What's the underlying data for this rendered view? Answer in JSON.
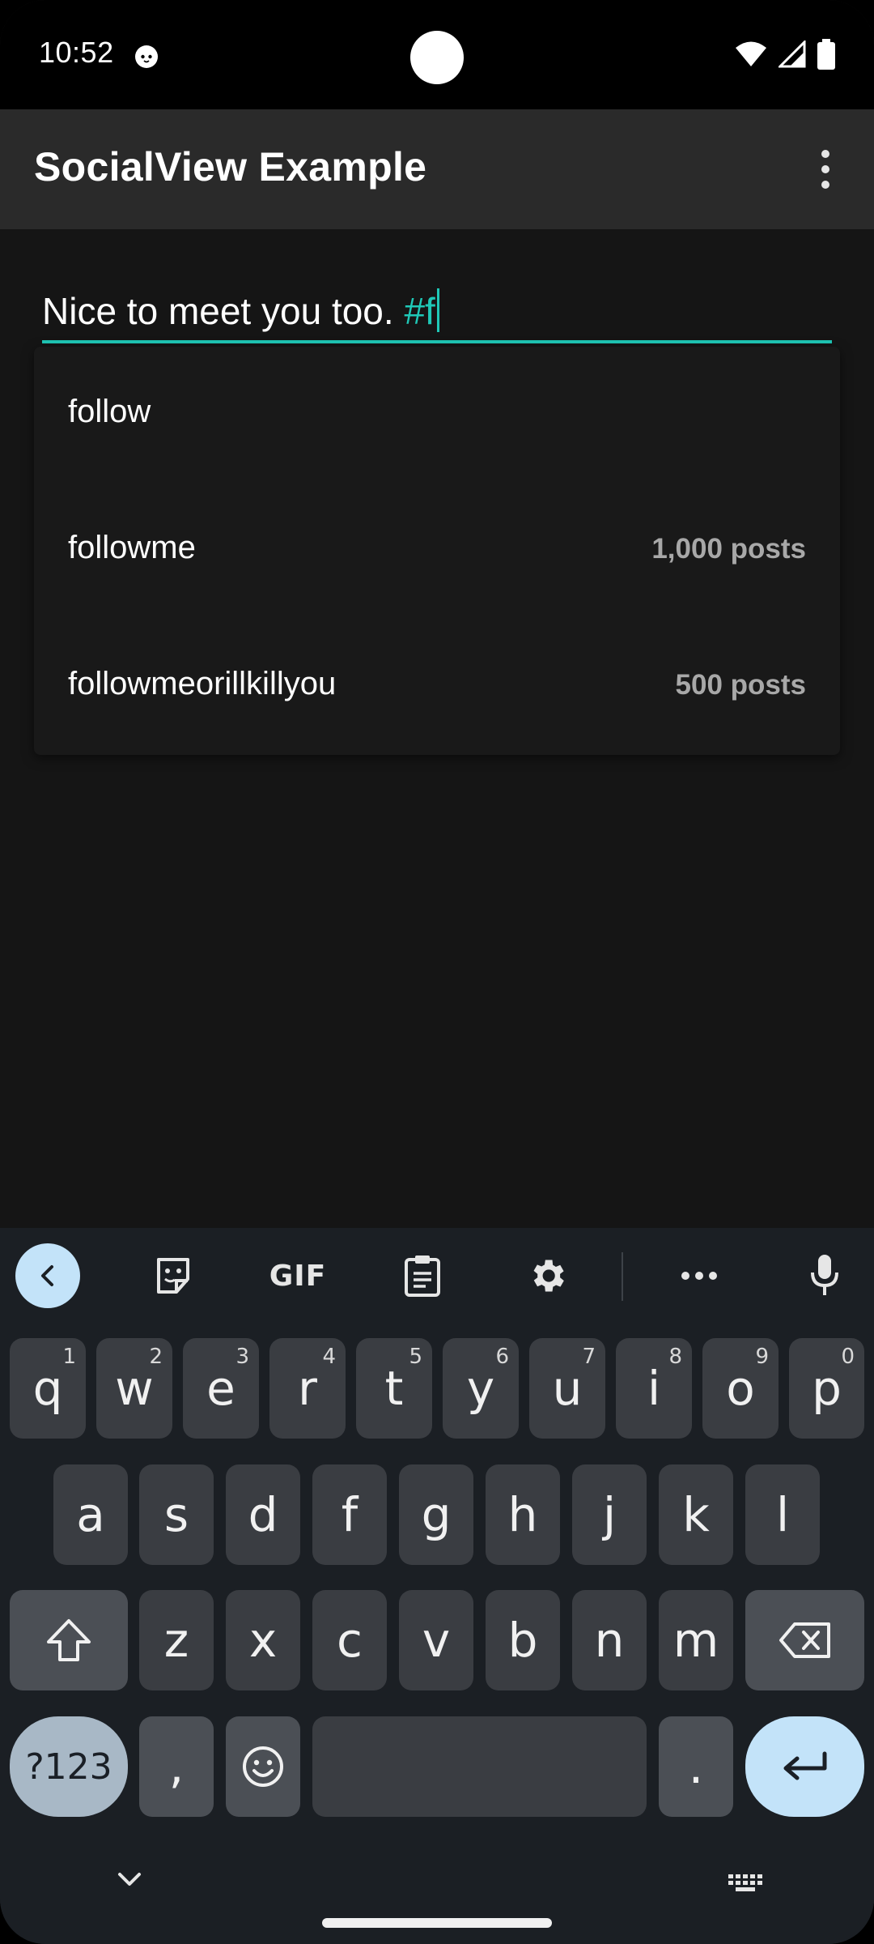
{
  "status": {
    "time": "10:52"
  },
  "appbar": {
    "title": "SocialView Example"
  },
  "input": {
    "text_prefix": "Nice to meet you too. ",
    "hashtag": "#f"
  },
  "suggestions": [
    {
      "name": "follow",
      "count": ""
    },
    {
      "name": "followme",
      "count": "1,000 posts"
    },
    {
      "name": "followmeorillkillyou",
      "count": "500 posts"
    }
  ],
  "keyboard": {
    "toolbar": {
      "gif_label": "GIF"
    },
    "row1": [
      {
        "key": "q",
        "hint": "1"
      },
      {
        "key": "w",
        "hint": "2"
      },
      {
        "key": "e",
        "hint": "3"
      },
      {
        "key": "r",
        "hint": "4"
      },
      {
        "key": "t",
        "hint": "5"
      },
      {
        "key": "y",
        "hint": "6"
      },
      {
        "key": "u",
        "hint": "7"
      },
      {
        "key": "i",
        "hint": "8"
      },
      {
        "key": "o",
        "hint": "9"
      },
      {
        "key": "p",
        "hint": "0"
      }
    ],
    "row2": [
      "a",
      "s",
      "d",
      "f",
      "g",
      "h",
      "j",
      "k",
      "l"
    ],
    "row3": [
      "z",
      "x",
      "c",
      "v",
      "b",
      "n",
      "m"
    ],
    "symbols_label": "?123",
    "comma": ",",
    "period": "."
  },
  "colors": {
    "accent": "#1fc8b7",
    "appbar": "#2a2a2a",
    "background": "#151515",
    "keyboard": "#1b1f24"
  }
}
